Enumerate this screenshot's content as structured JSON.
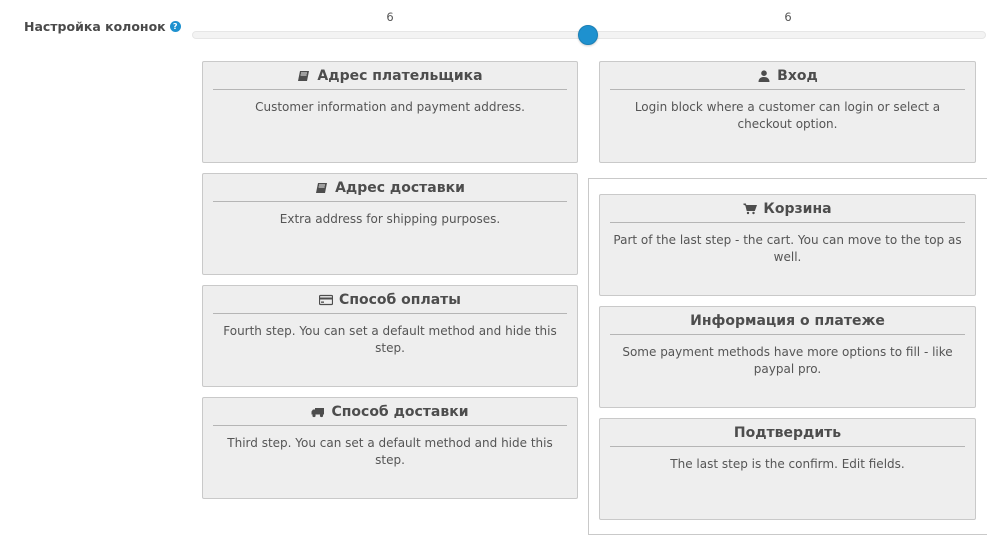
{
  "settings": {
    "label": "Настройка колонок",
    "help_icon": "?"
  },
  "slider": {
    "left_value": "6",
    "right_value": "6",
    "accent": "#1e91cf"
  },
  "left_column": [
    {
      "icon": "book-icon",
      "title": "Адрес плательщика",
      "description": "Customer information and payment address."
    },
    {
      "icon": "book-icon",
      "title": "Адрес доставки",
      "description": "Extra address for shipping purposes."
    },
    {
      "icon": "credit-card-icon",
      "title": "Способ оплаты",
      "description": "Fourth step. You can set a default method and hide this step."
    },
    {
      "icon": "truck-icon",
      "title": "Способ доставки",
      "description": "Third step. You can set a default method and hide this step."
    }
  ],
  "right_column_top": [
    {
      "icon": "user-icon",
      "title": "Вход",
      "description": "Login block where a customer can login or select a checkout option."
    }
  ],
  "right_column": [
    {
      "icon": "cart-icon",
      "title": "Корзина",
      "description": "Part of the last step - the cart. You can move to the top as well."
    },
    {
      "icon": "",
      "title": "Информация о платеже",
      "description": "Some payment methods have more options to fill - like paypal pro."
    },
    {
      "icon": "",
      "title": "Подтвердить",
      "description": "The last step is the confirm. Edit fields."
    }
  ]
}
